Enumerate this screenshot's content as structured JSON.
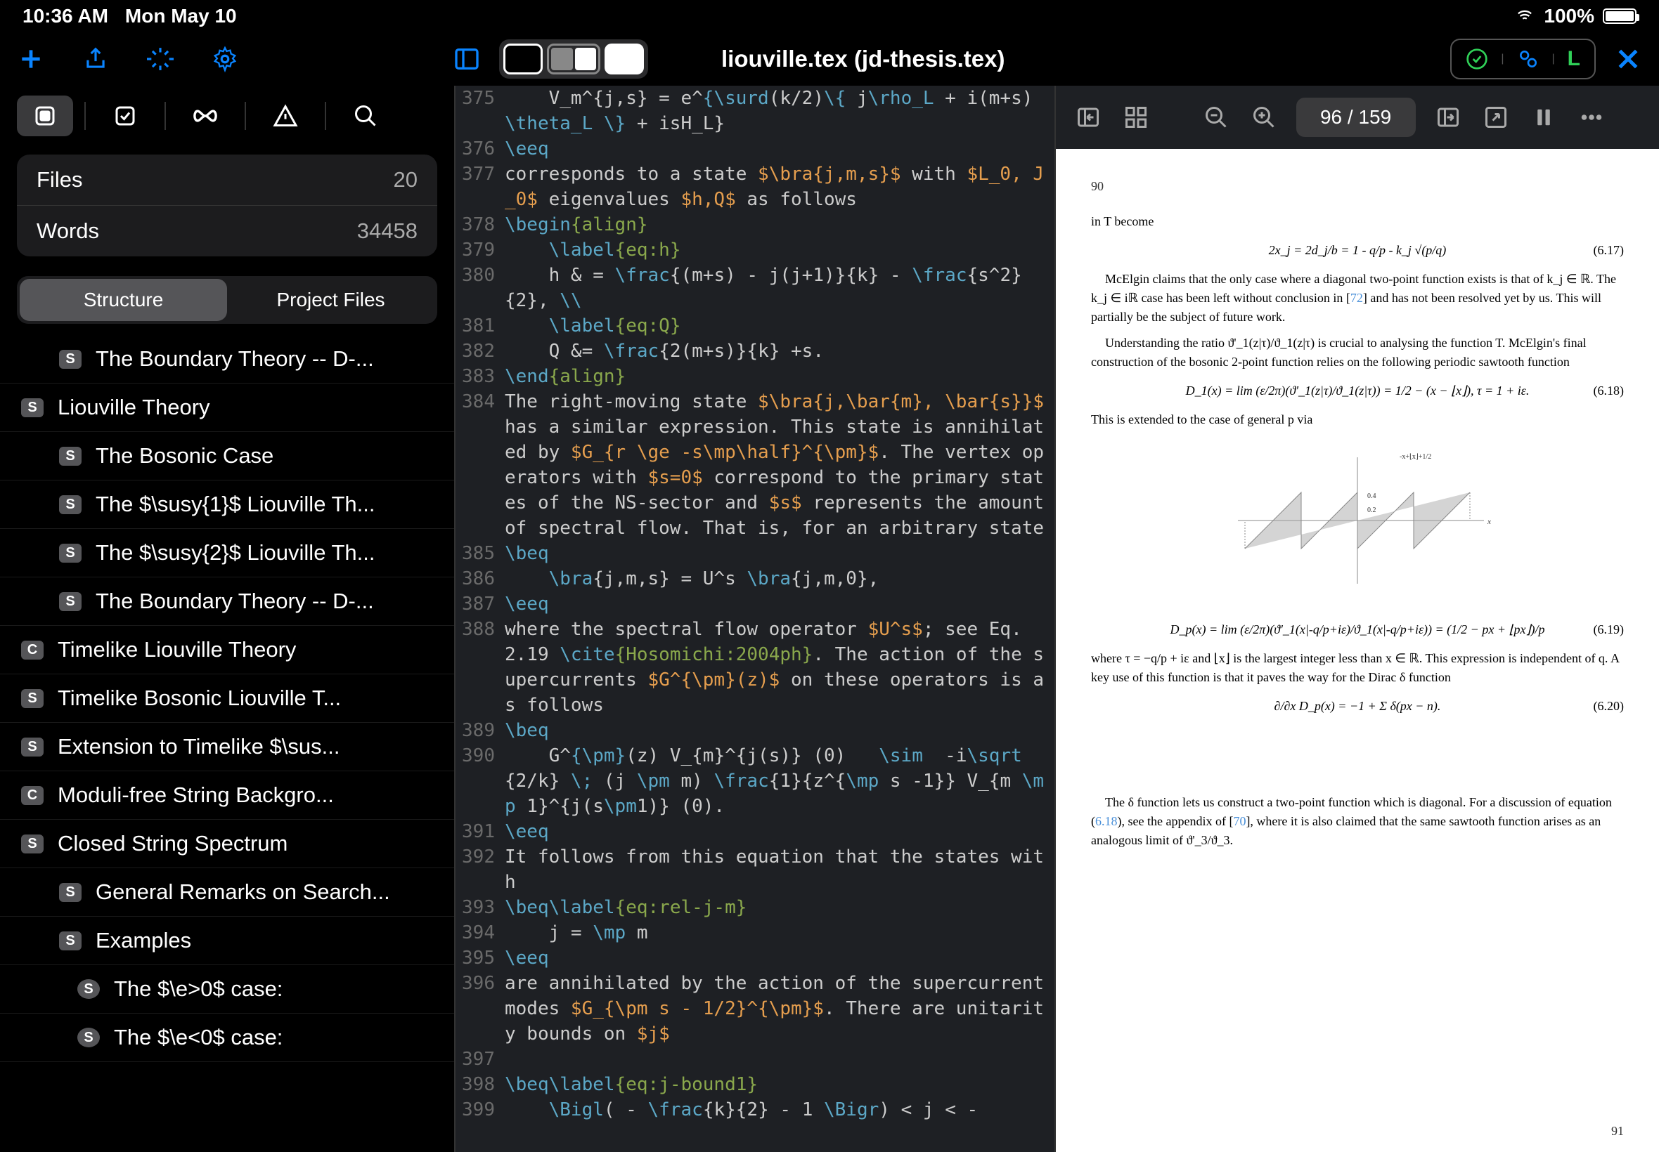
{
  "status": {
    "time": "10:36 AM",
    "date": "Mon May 10",
    "battery": "100%"
  },
  "toolbar": {
    "title": "liouville.tex (jd-thesis.tex)",
    "lang": "L"
  },
  "sidebar": {
    "stats": [
      {
        "label": "Files",
        "value": "20"
      },
      {
        "label": "Words",
        "value": "34458"
      }
    ],
    "tabs": [
      "Structure",
      "Project Files"
    ],
    "outline": [
      {
        "type": "S",
        "label": "The Boundary Theory -- D-...",
        "d": 1
      },
      {
        "type": "S",
        "label": "Liouville Theory",
        "d": 0
      },
      {
        "type": "S",
        "label": "The Bosonic Case",
        "d": 1
      },
      {
        "type": "S",
        "label": "The $\\susy{1}$ Liouville Th...",
        "d": 1
      },
      {
        "type": "S",
        "label": "The $\\susy{2}$ Liouville Th...",
        "d": 1
      },
      {
        "type": "S",
        "label": "The Boundary Theory -- D-...",
        "d": 1
      },
      {
        "type": "C",
        "label": "Timelike Liouville Theory",
        "d": 0
      },
      {
        "type": "S",
        "label": "Timelike Bosonic Liouville T...",
        "d": 0
      },
      {
        "type": "S",
        "label": "Extension to Timelike $\\sus...",
        "d": 0
      },
      {
        "type": "C",
        "label": "Moduli-free String Backgro...",
        "d": 0
      },
      {
        "type": "S",
        "label": "Closed String Spectrum",
        "d": 0
      },
      {
        "type": "S",
        "label": "General Remarks on Search...",
        "d": 1
      },
      {
        "type": "S",
        "label": "Examples",
        "d": 1
      },
      {
        "type": "SS",
        "label": "The $\\e>0$ case:",
        "d": 2
      },
      {
        "type": "SS",
        "label": "The $\\e<0$ case:",
        "d": 2
      }
    ]
  },
  "editor": {
    "lines": [
      {
        "n": 375,
        "h": "    V_m^{j,s} = e^<c>{\\surd</c>(k/2)<c>\\{</c> j<c>\\rho_L</c> + i(m+s) <c>\\theta_L \\}</c> + isH_L}"
      },
      {
        "n": 376,
        "h": "<c>\\eeq</c>"
      },
      {
        "n": 377,
        "h": "corresponds to a state <k>$\\bra{j,m,s}$</k> with <k>$L_0, J_0$</k> eigenvalues <k>$h,Q$</k> as follows"
      },
      {
        "n": 378,
        "h": "<c>\\begin</c><g>{align}</g>"
      },
      {
        "n": 379,
        "h": "    <c>\\label</c><g>{eq:h}</g>"
      },
      {
        "n": 380,
        "h": "    h & = <c>\\frac</c>{(m+s) - j(j+1)}{k} - <c>\\frac</c>{s^2}{2}, <c>\\\\</c>"
      },
      {
        "n": 381,
        "h": "    <c>\\label</c><g>{eq:Q}</g>"
      },
      {
        "n": 382,
        "h": "    Q &= <c>\\frac</c>{2(m+s)}{k} +s."
      },
      {
        "n": 383,
        "h": "<c>\\end</c><g>{align}</g>"
      },
      {
        "n": 384,
        "h": "The right-moving state <k>$\\bra{j,\\bar{m}, \\bar{s}}$</k> has a similar expression. This state is annihilated by <k>$G_{r \\ge -s\\mp\\half}^{\\pm}$</k>. The vertex operators with <k>$s=0$</k> correspond to the primary states of the NS-sector and <k>$s$</k> represents the amount of spectral flow. That is, for an arbitrary state"
      },
      {
        "n": 385,
        "h": "<c>\\beq</c>"
      },
      {
        "n": 386,
        "h": "    <c>\\bra</c>{j,m,s} = U^s <c>\\bra</c>{j,m,0},"
      },
      {
        "n": 387,
        "h": "<c>\\eeq</c>"
      },
      {
        "n": 388,
        "h": "where the spectral flow operator <k>$U^s$</k>; see Eq. 2.19 <c>\\cite</c><g>{Hosomichi:2004ph}</g>. The action of the supercurrents <k>$G^{\\pm}(z)$</k> on these operators is as follows"
      },
      {
        "n": 389,
        "h": "<c>\\beq</c>"
      },
      {
        "n": 390,
        "h": "    G^<c>{\\pm}</c>(z) V_{m}^{j(s)} (0)   <c>\\sim</c>  -i<c>\\sqrt</c>{2/k} <c>\\;</c> (j <c>\\pm</c> m) <c>\\frac</c>{1}{z^{<c>\\mp</c> s -1}} V_{m <c>\\mp</c> 1}^{j(s<c>\\pm</c>1)} (0)."
      },
      {
        "n": 391,
        "h": "<c>\\eeq</c>"
      },
      {
        "n": 392,
        "h": "It follows from this equation that the states with"
      },
      {
        "n": 393,
        "h": "<c>\\beq\\label</c><g>{eq:rel-j-m}</g>"
      },
      {
        "n": 394,
        "h": "    j = <c>\\mp</c> m"
      },
      {
        "n": 395,
        "h": "<c>\\eeq</c>"
      },
      {
        "n": 396,
        "h": "are annihilated by the action of the supercurrent modes <k>$G_{\\pm s - 1/2}^{\\pm}$</k>. There are unitarity bounds on <k>$j$</k>"
      },
      {
        "n": 397,
        "h": ""
      },
      {
        "n": 398,
        "h": "<c>\\beq\\label</c><g>{eq:j-bound1}</g>"
      },
      {
        "n": 399,
        "h": "    <c>\\Bigl</c>( - <c>\\frac</c>{k}{2} - 1 <c>\\Bigr</c>) < j < -"
      }
    ]
  },
  "preview": {
    "page": "96 / 159",
    "pgTop": "90",
    "pgBottom": "91",
    "body": {
      "l1": "in T become",
      "eq1": "2x_j = 2d_j/b = 1 - q/p - k_j √(p/q)",
      "eqn1": "(6.17)",
      "p1a": "McElgin claims that the only case where a diagonal two-point function exists is that of k_j ∈ ℝ. The k_j ∈ iℝ case has been left without conclusion in [",
      "p1cite": "72",
      "p1b": "] and has not been resolved yet by us. This will partially be the subject of future work.",
      "p2": "Understanding the ratio ϑ'_1(z|τ)/ϑ_1(z|τ) is crucial to analysing the function T. McElgin's final construction of the bosonic 2-point function relies on the following periodic sawtooth function",
      "eq2": "D_1(x) = lim (ε/2π)(ϑ'_1(z|τ)/ϑ_1(z|τ)) = 1/2 − (x − ⌊x⌋),      τ = 1 + iε.",
      "eqn2": "(6.18)",
      "p3": "This is extended to the case of general p via",
      "eq3": "D_p(x) = lim (ε/2π)(ϑ'_1(x|-q/p+iε)/ϑ_1(x|-q/p+iε)) = (1/2 − px + ⌊px⌋)/p",
      "eqn3": "(6.19)",
      "p4": "where τ = −q/p + iε and ⌊x⌋ is the largest integer less than x ∈ ℝ. This expression is independent of q. A key use of this function is that it paves the way for the Dirac δ function",
      "eq4": "∂/∂x D_p(x) = −1 + Σ δ(px − n).",
      "eqn4": "(6.20)",
      "p5a": "The δ function lets us construct a two-point function which is diagonal. For a discussion of equation (",
      "p5cite1": "6.18",
      "p5b": "), see the appendix of [",
      "p5cite2": "70",
      "p5c": "], where it is also claimed that the same sawtooth function arises as an analogous limit of ϑ'_3/ϑ_3."
    }
  }
}
